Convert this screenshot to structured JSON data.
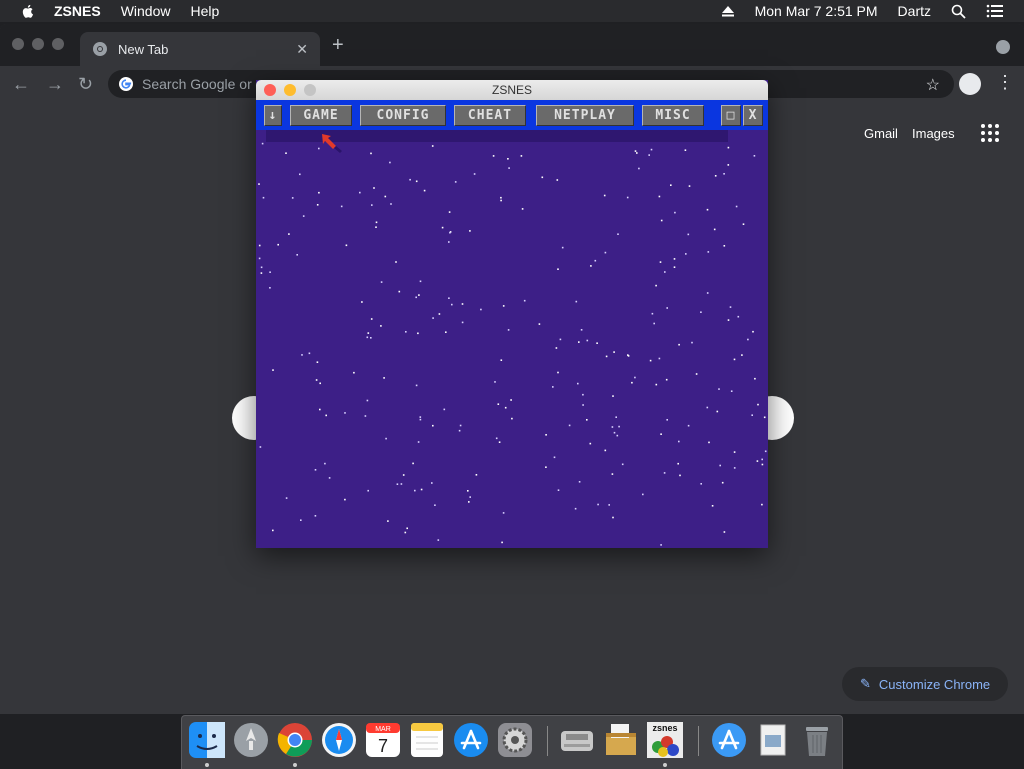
{
  "menubar": {
    "app_name": "ZSNES",
    "menus": [
      "Window",
      "Help"
    ],
    "datetime": "Mon Mar 7  2:51 PM",
    "user": "Dartz"
  },
  "chrome": {
    "tab_title": "New Tab",
    "omnibox_placeholder": "Search Google or type a URL",
    "omnibox_visible": "Search Google or",
    "links": {
      "gmail": "Gmail",
      "images": "Images"
    },
    "customize_label": "Customize Chrome"
  },
  "zsnes": {
    "title": "ZSNES",
    "menu_arrow": "↓",
    "menu": [
      "GAME",
      "CONFIG",
      "CHEAT",
      "NETPLAY",
      "MISC"
    ],
    "minimize_glyph": "□",
    "close_glyph": "X"
  },
  "dock": {
    "apps": [
      "finder-icon",
      "launchpad-icon",
      "chrome-icon",
      "safari-icon",
      "calendar-icon",
      "notes-icon",
      "app-store-icon",
      "system-preferences-icon",
      "snes-icon",
      "archive-utility-icon",
      "zsnes-icon",
      "app-store-folder-icon",
      "preview-icon",
      "trash-icon"
    ],
    "calendar_month": "MAR",
    "calendar_day": "7",
    "zsnes_label": "zsnes"
  },
  "colors": {
    "zsnes_bg": "#3d1f87",
    "zsnes_menubar": "#0a36e0",
    "chrome_bg": "#35363a",
    "accent_link": "#8ab4f8"
  }
}
